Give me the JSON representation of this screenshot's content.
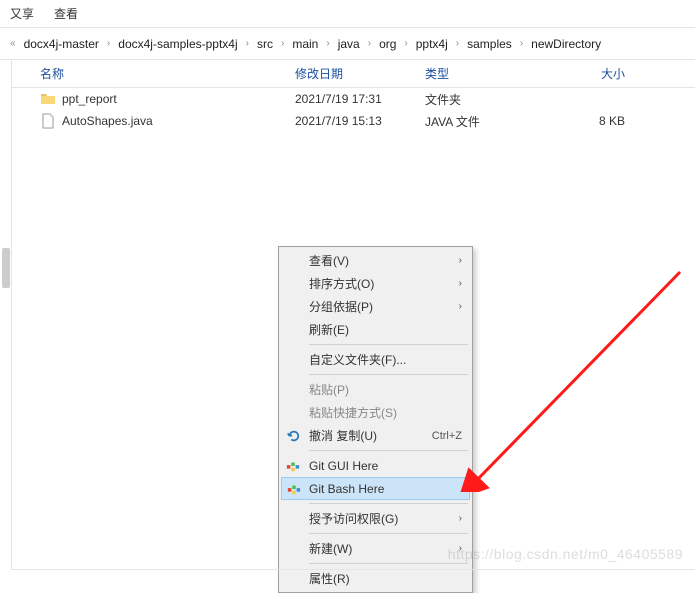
{
  "topbar": {
    "share": "又享",
    "view": "查看"
  },
  "breadcrumb": {
    "prefix": "«",
    "items": [
      "docx4j-master",
      "docx4j-samples-pptx4j",
      "src",
      "main",
      "java",
      "org",
      "pptx4j",
      "samples",
      "newDirectory"
    ]
  },
  "columns": {
    "name": "名称",
    "date": "修改日期",
    "type": "类型",
    "size": "大小"
  },
  "files": [
    {
      "name": "ppt_report",
      "date": "2021/7/19 17:31",
      "type": "文件夹",
      "size": "",
      "kind": "folder"
    },
    {
      "name": "AutoShapes.java",
      "date": "2021/7/19 15:13",
      "type": "JAVA 文件",
      "size": "8 KB",
      "kind": "file"
    }
  ],
  "menu": {
    "view": "查看(V)",
    "sort": "排序方式(O)",
    "group": "分组依据(P)",
    "refresh": "刷新(E)",
    "customize": "自定义文件夹(F)...",
    "paste": "粘贴(P)",
    "paste_shortcut": "粘贴快捷方式(S)",
    "undo": "撤消 复制(U)",
    "undo_key": "Ctrl+Z",
    "git_gui": "Git GUI Here",
    "git_bash": "Git Bash Here",
    "access": "授予访问权限(G)",
    "new": "新建(W)",
    "properties": "属性(R)"
  },
  "watermark": "https://blog.csdn.net/m0_46405589"
}
